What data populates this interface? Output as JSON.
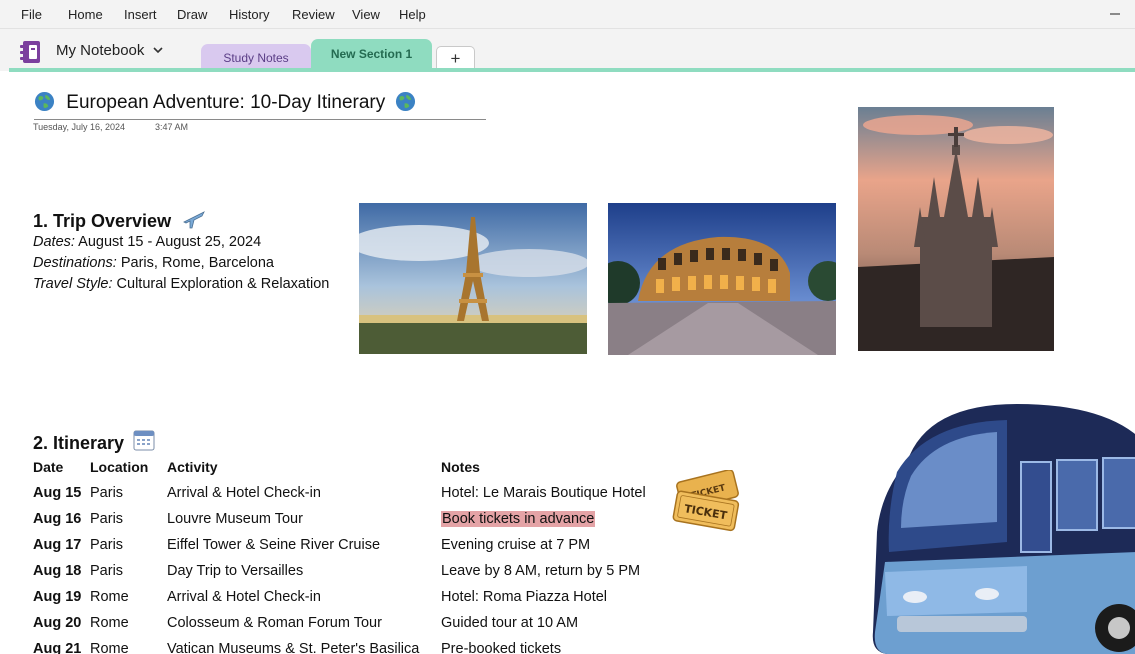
{
  "menu": [
    "File",
    "Home",
    "Insert",
    "Draw",
    "History",
    "Review",
    "View",
    "Help"
  ],
  "notebook": {
    "name": "My Notebook"
  },
  "sections": [
    {
      "label": "Study Notes",
      "color": "#d9c9ef"
    },
    {
      "label": "New Section 1",
      "color": "#8fdcc0",
      "active": true
    }
  ],
  "add_section_label": "+",
  "page": {
    "title": "European Adventure: 10-Day Itinerary",
    "date": "Tuesday, July 16, 2024",
    "time": "3:47 AM"
  },
  "overview": {
    "heading": "1. Trip Overview",
    "dates_label": "Dates:",
    "dates_value": "August 15 - August 25, 2024",
    "destinations_label": "Destinations:",
    "destinations_value": "Paris, Rome, Barcelona",
    "style_label": "Travel Style:",
    "style_value": "Cultural Exploration & Relaxation"
  },
  "images": [
    "eiffel-tower-photo",
    "colosseum-photo",
    "sagrat-cor-church-photo",
    "tour-bus-illustration",
    "ticket-sticker"
  ],
  "itinerary": {
    "heading": "2. Itinerary",
    "columns": [
      "Date",
      "Location",
      "Activity",
      "Notes"
    ],
    "rows": [
      {
        "date": "Aug 15",
        "location": "Paris",
        "activity": "Arrival & Hotel Check-in",
        "notes": "Hotel: Le Marais Boutique Hotel"
      },
      {
        "date": "Aug 16",
        "location": "Paris",
        "activity": "Louvre Museum Tour",
        "notes": "Book tickets in advance",
        "highlight": true
      },
      {
        "date": "Aug 17",
        "location": "Paris",
        "activity": "Eiffel Tower & Seine River Cruise",
        "notes": "Evening cruise at 7 PM"
      },
      {
        "date": "Aug 18",
        "location": "Paris",
        "activity": "Day Trip to Versailles",
        "notes": "Leave by 8 AM, return by 5 PM"
      },
      {
        "date": "Aug 19",
        "location": "Rome",
        "activity": "Arrival & Hotel Check-in",
        "notes": "Hotel: Roma Piazza Hotel"
      },
      {
        "date": "Aug 20",
        "location": "Rome",
        "activity": "Colosseum & Roman Forum Tour",
        "notes": "Guided tour at 10 AM"
      },
      {
        "date": "Aug 21",
        "location": "Rome",
        "activity": "Vatican Museums & St. Peter's Basilica",
        "notes": "Pre-booked tickets"
      }
    ]
  },
  "ticket_text": "TICKET",
  "colors": {
    "section_accent": "#8fdcc0",
    "highlight": "#e4a3a6",
    "notebook_purple": "#7b3f9e"
  }
}
